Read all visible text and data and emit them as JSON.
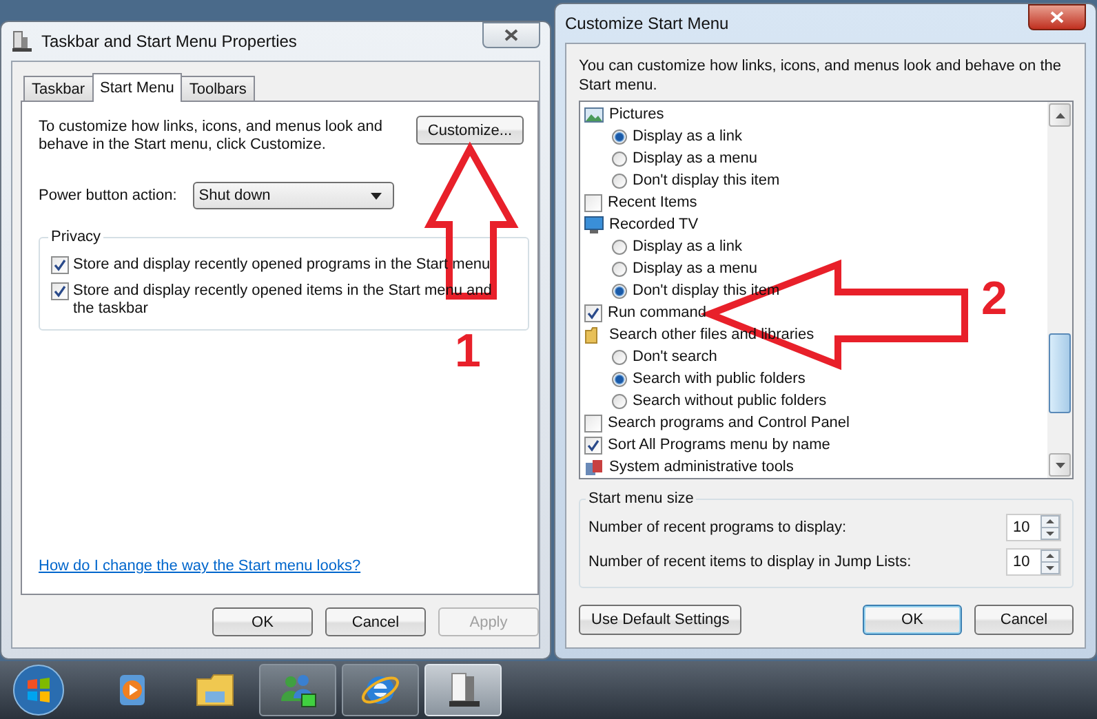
{
  "left_window": {
    "title": "Taskbar and Start Menu Properties",
    "tabs": [
      {
        "label": "Taskbar",
        "selected": false
      },
      {
        "label": "Start Menu",
        "selected": true
      },
      {
        "label": "Toolbars",
        "selected": false
      }
    ],
    "description": "To customize how links, icons, and menus look and behave in the Start menu, click Customize.",
    "customize_button": "Customize...",
    "power_label": "Power button action:",
    "power_value": "Shut down",
    "privacy": {
      "legend": "Privacy",
      "options": [
        {
          "label": "Store and display recently opened programs in the Start menu",
          "checked": true
        },
        {
          "label": "Store and display recently opened items in the Start menu and the taskbar",
          "checked": true
        }
      ]
    },
    "help_link": "How do I change the way the Start menu looks?",
    "buttons": [
      {
        "label": "OK",
        "disabled": false
      },
      {
        "label": "Cancel",
        "disabled": false
      },
      {
        "label": "Apply",
        "disabled": true
      }
    ]
  },
  "right_window": {
    "title": "Customize Start Menu",
    "description": "You can customize how links, icons, and menus look and behave on the Start menu.",
    "list": [
      {
        "kind": "heading",
        "label": "Pictures",
        "children": [
          {
            "kind": "radio",
            "label": "Display as a link",
            "selected": true
          },
          {
            "kind": "radio",
            "label": "Display as a menu",
            "selected": false
          },
          {
            "kind": "radio",
            "label": "Don't display this item",
            "selected": false
          }
        ]
      },
      {
        "kind": "checkbox",
        "label": "Recent Items",
        "checked": false
      },
      {
        "kind": "heading",
        "label": "Recorded TV",
        "children": [
          {
            "kind": "radio",
            "label": "Display as a link",
            "selected": false
          },
          {
            "kind": "radio",
            "label": "Display as a menu",
            "selected": false
          },
          {
            "kind": "radio",
            "label": "Don't display this item",
            "selected": true
          }
        ]
      },
      {
        "kind": "checkbox",
        "label": "Run command",
        "checked": true
      },
      {
        "kind": "heading",
        "label": "Search other files and libraries",
        "children": [
          {
            "kind": "radio",
            "label": "Don't search",
            "selected": false
          },
          {
            "kind": "radio",
            "label": "Search with public folders",
            "selected": true
          },
          {
            "kind": "radio",
            "label": "Search without public folders",
            "selected": false
          }
        ]
      },
      {
        "kind": "checkbox",
        "label": "Search programs and Control Panel",
        "checked": false
      },
      {
        "kind": "checkbox",
        "label": "Sort All Programs menu by name",
        "checked": true
      },
      {
        "kind": "heading",
        "label": "System administrative tools"
      }
    ],
    "size_group": {
      "legend": "Start menu size",
      "spinners": [
        {
          "label": "Number of recent programs to display:",
          "value": "10"
        },
        {
          "label": "Number of recent items to display in Jump Lists:",
          "value": "10"
        }
      ]
    },
    "default_button": "Use Default Settings",
    "buttons": [
      {
        "label": "OK",
        "default": true
      },
      {
        "label": "Cancel",
        "default": false
      }
    ]
  },
  "annotations": [
    {
      "number": "1"
    },
    {
      "number": "2"
    }
  ],
  "taskbar": {
    "items": [
      {
        "running": false,
        "selected": false
      },
      {
        "running": false,
        "selected": false
      },
      {
        "running": true,
        "selected": false
      },
      {
        "running": true,
        "selected": false
      },
      {
        "running": true,
        "selected": true
      }
    ]
  }
}
